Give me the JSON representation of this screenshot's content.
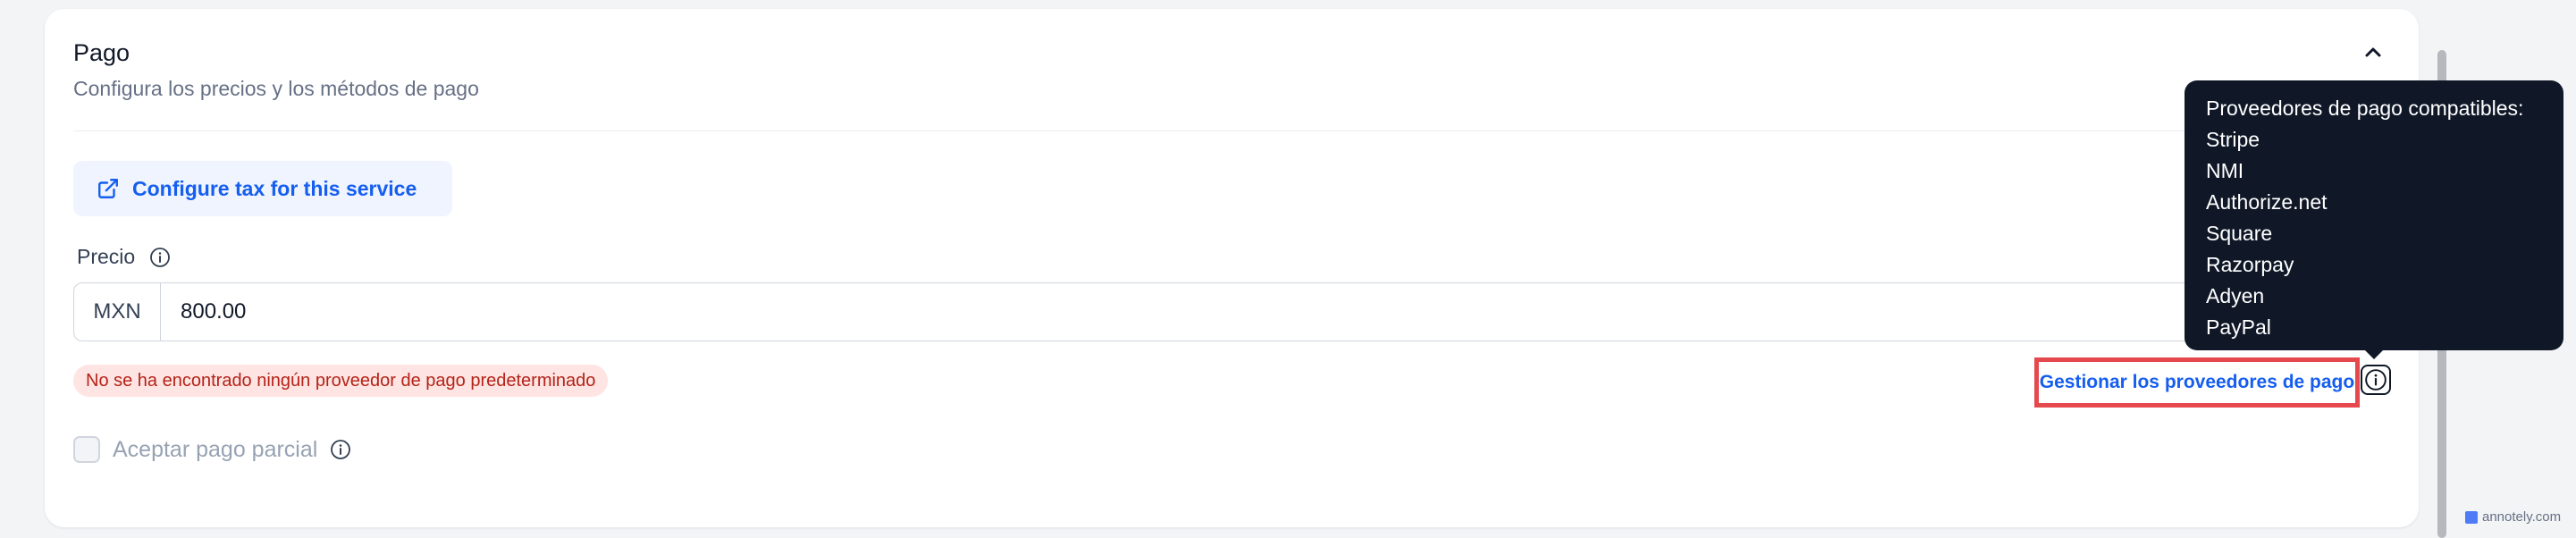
{
  "section": {
    "title": "Pago",
    "subtitle": "Configura los precios y los métodos de pago"
  },
  "tax_button": {
    "label": "Configure tax for this service"
  },
  "price": {
    "label": "Precio",
    "currency": "MXN",
    "value": "800.00"
  },
  "error": {
    "message": "No se ha encontrado ningún proveedor de pago predeterminado"
  },
  "manage_providers": {
    "label": "Gestionar los proveedores de pago"
  },
  "partial_payment": {
    "label": "Aceptar pago parcial",
    "checked": false
  },
  "tooltip": {
    "title": "Proveedores de pago compatibles:",
    "providers": [
      "Stripe",
      "NMI",
      "Authorize.net",
      "Square",
      "Razorpay",
      "Adyen",
      "PayPal"
    ]
  },
  "watermark": "annotely.com",
  "colors": {
    "accent": "#155eef",
    "error_bg": "#fee4e2",
    "error_text": "#b42318",
    "highlight_border": "#e5484d",
    "tooltip_bg": "#101828"
  }
}
